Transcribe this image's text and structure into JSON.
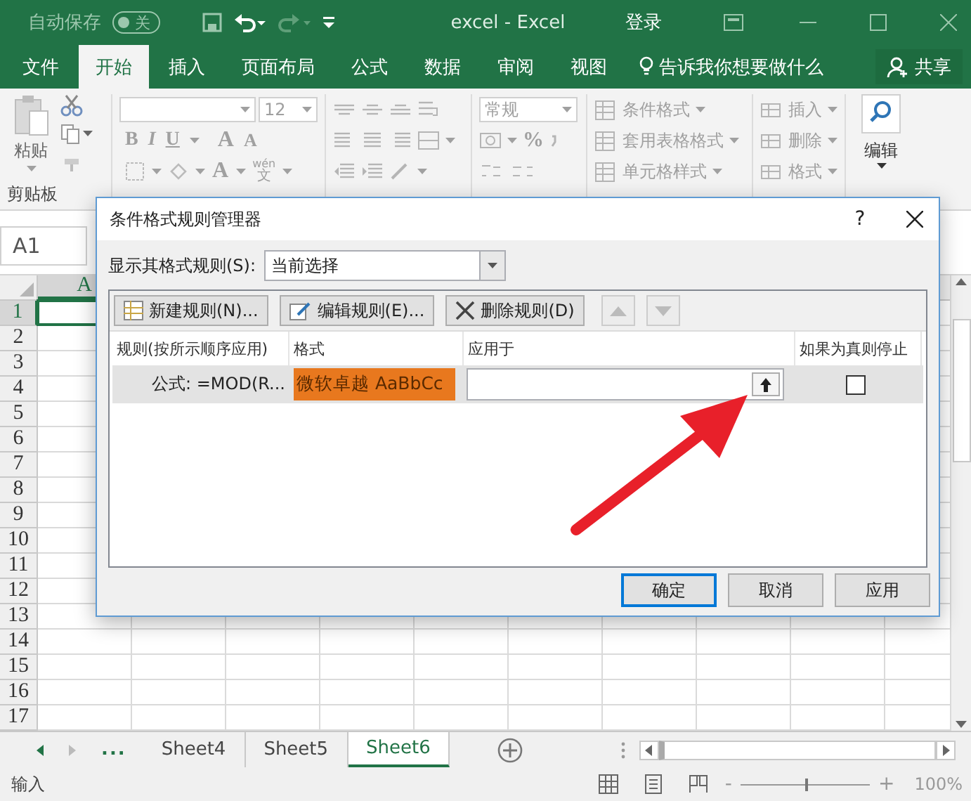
{
  "titlebar": {
    "autosave_label": "自动保存",
    "autosave_toggle": "关",
    "autosave_on": false,
    "title": "excel  -  Excel",
    "signin": "登录"
  },
  "ribbon_tabs": [
    {
      "label": "文件",
      "selected": false
    },
    {
      "label": "开始",
      "selected": true
    },
    {
      "label": "插入",
      "selected": false
    },
    {
      "label": "页面布局",
      "selected": false
    },
    {
      "label": "公式",
      "selected": false
    },
    {
      "label": "数据",
      "selected": false
    },
    {
      "label": "审阅",
      "selected": false
    },
    {
      "label": "视图",
      "selected": false
    }
  ],
  "tell_me": "告诉我你想要做什么",
  "share": "共享",
  "ribbon": {
    "clipboard": {
      "paste": "粘贴",
      "group": "剪贴板"
    },
    "font": {
      "size": "12",
      "styles": [
        "B",
        "I",
        "U"
      ],
      "grow": "A",
      "shrink": "A",
      "color_letter": "A",
      "phonetic_top": "wén",
      "phonetic_bottom": "文"
    },
    "number": {
      "format": "常规",
      "percent": "%"
    },
    "styles": [
      "条件格式",
      "套用表格格式",
      "单元格样式"
    ],
    "cells": [
      "插入",
      "删除",
      "格式"
    ],
    "editing": "编辑"
  },
  "name_box": "A1",
  "grid": {
    "columns": [
      {
        "label": "A",
        "selected": true
      }
    ],
    "rows": [
      {
        "label": "1",
        "selected": true
      },
      {
        "label": "2",
        "selected": false
      },
      {
        "label": "3",
        "selected": false
      },
      {
        "label": "4",
        "selected": false
      },
      {
        "label": "5",
        "selected": false
      },
      {
        "label": "6",
        "selected": false
      },
      {
        "label": "7",
        "selected": false
      },
      {
        "label": "8",
        "selected": false
      },
      {
        "label": "9",
        "selected": false
      },
      {
        "label": "10",
        "selected": false
      },
      {
        "label": "11",
        "selected": false
      },
      {
        "label": "12",
        "selected": false
      },
      {
        "label": "13",
        "selected": false
      },
      {
        "label": "14",
        "selected": false
      },
      {
        "label": "15",
        "selected": false
      },
      {
        "label": "16",
        "selected": false
      },
      {
        "label": "17",
        "selected": false
      }
    ]
  },
  "sheet_tabs": {
    "more": "...",
    "tabs": [
      {
        "label": "Sheet4",
        "selected": false
      },
      {
        "label": "Sheet5",
        "selected": false
      },
      {
        "label": "Sheet6",
        "selected": true
      }
    ]
  },
  "status": {
    "mode": "输入",
    "zoom_out": "-",
    "zoom_in": "+",
    "zoom_slider": {
      "level": 0.5
    },
    "zoom": "100%"
  },
  "dialog": {
    "title": "条件格式规则管理器",
    "help": "?",
    "show_label": "显示其格式规则(S):",
    "show_value": "当前选择",
    "toolbar": [
      {
        "label": "新建规则(N)...",
        "kind": "new"
      },
      {
        "label": "编辑规则(E)...",
        "kind": "edit"
      },
      {
        "label": "删除规则(D)",
        "kind": "delete"
      }
    ],
    "move_buttons": [
      {
        "kind": "up",
        "disabled": true
      },
      {
        "kind": "down",
        "disabled": true
      }
    ],
    "columns": [
      "规则(按所示顺序应用)",
      "格式",
      "应用于",
      "如果为真则停止"
    ],
    "rules": [
      {
        "rule": "公式: =MOD(R...",
        "preview": "微软卓越  AaBbCc",
        "color": "#e8781e",
        "stop_if_true": false,
        "selected": true
      }
    ],
    "buttons": [
      {
        "label": "确定",
        "default": true
      },
      {
        "label": "取消",
        "default": false
      },
      {
        "label": "应用",
        "default": false
      }
    ]
  }
}
